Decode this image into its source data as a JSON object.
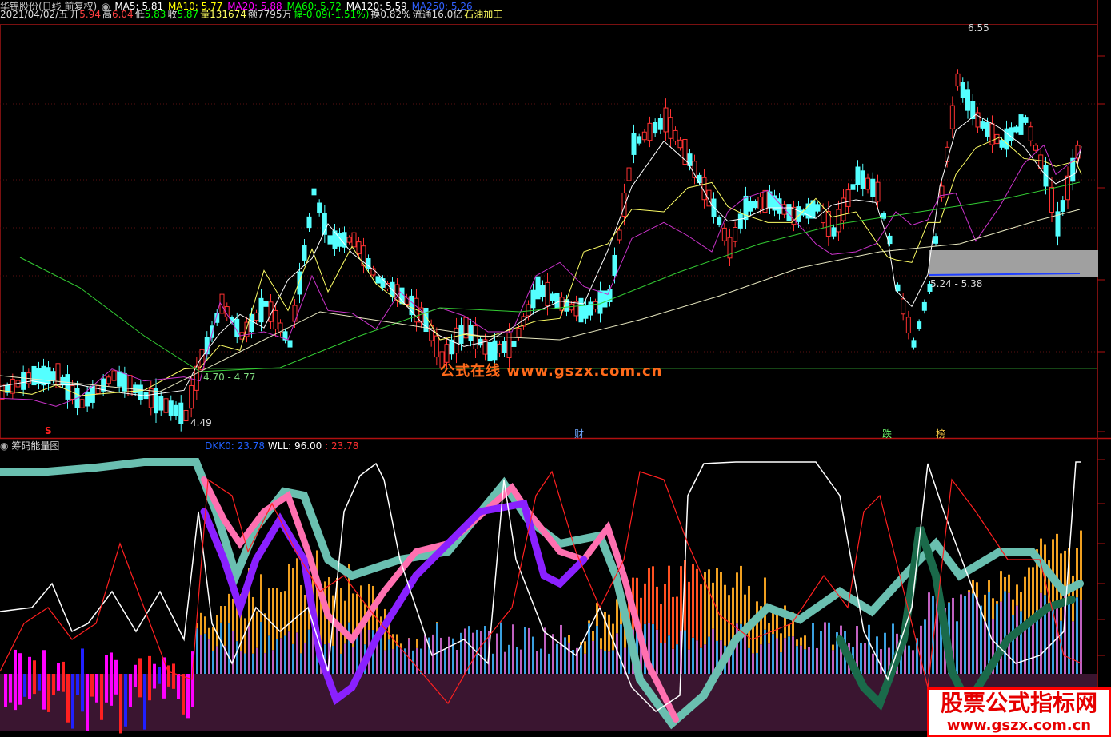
{
  "header": {
    "title": "华锦股份(日线 前复权)",
    "ma5": "MA5: 5.81",
    "ma10": "MA10: 5.77",
    "ma20": "MA20: 5.88",
    "ma60": "MA60: 5.72",
    "ma120": "MA120: 5.59",
    "ma250": "MA250: 5.26"
  },
  "quote": {
    "date": "2021/04/02/五",
    "open_label": "开",
    "open": "5.94",
    "high_label": "高",
    "high": "6.04",
    "low_label": "低",
    "low": "5.83",
    "close_label": "收",
    "close": "5.87",
    "vol": "量131674",
    "amount": "额7795万",
    "change": "幅-0.09(-1.51%)",
    "turnover": "换0.82%",
    "float": "流通16.0亿",
    "industry": "石油加工"
  },
  "price_labels": {
    "high_mark": "6.55",
    "range_mark": "5.24 - 5.38",
    "low_range": "4.70 - 4.77",
    "low_mark": "4.49"
  },
  "markers": {
    "s": "S",
    "cai": "财",
    "die": "跌",
    "bang": "榜"
  },
  "indicator": {
    "name": "筹码能量图",
    "dkk_label": "DKK0:",
    "dkk_value": "23.78",
    "wll_label": "WLL:",
    "wll_value": "96.00",
    "extra": ": 23.78"
  },
  "watermark": "公式在线 www.gszx.com.cn",
  "brand": {
    "line1": "股票公式指标网",
    "line2": "www.gszx.com.cn"
  },
  "colors": {
    "up": "#ff3232",
    "down": "#54ffff",
    "ma5": "#ffffff",
    "ma10": "#ffff00",
    "ma20": "#ff00ff",
    "ma60": "#00ff00",
    "ma120": "#ffffff",
    "ma250": "#0000ff"
  }
}
